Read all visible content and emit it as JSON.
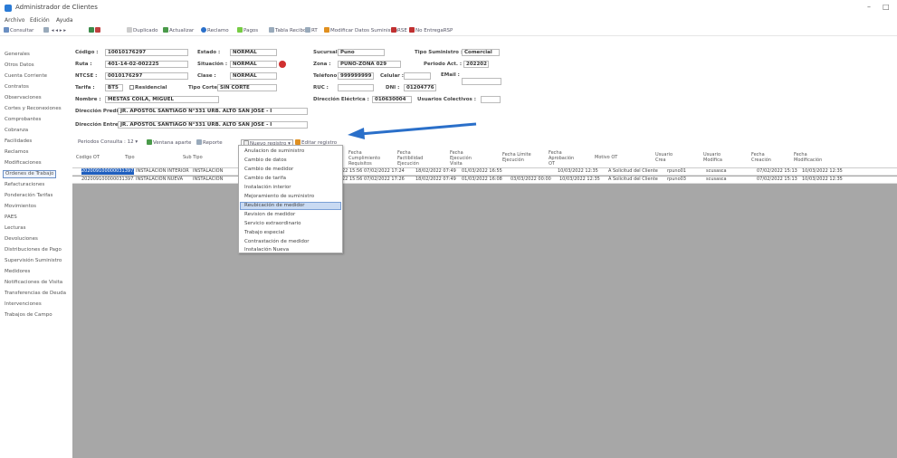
{
  "window": {
    "title": "Administrador de Clientes",
    "minimize": "–",
    "maximize": "□"
  },
  "menu": [
    "Archivo",
    "Edición",
    "Ayuda"
  ],
  "toolbar": {
    "consultar": "Consultar",
    "duplicado": "Duplicado",
    "actualizar": "Actualizar",
    "reclamo": "Reclamo",
    "pagos": "Pagos",
    "tabla_recibo": "Tabla Recibo",
    "rt": "RT",
    "modificar": "Modificar Datos Suministro",
    "rse": "RSE",
    "no_entrega": "No EntregaRSP"
  },
  "sidebar": [
    "Generales",
    "Otros Datos",
    "Cuenta Corriente",
    "Contratos",
    "Observaciones",
    "Cortes y Reconexiones",
    "Comprobantes",
    "Cobranza",
    "Facilidades",
    "Reclamos",
    "Modificaciones",
    "Ordenes de Trabajo",
    "Refacturaciones",
    "Ponderación Tarifas",
    "Movimientos",
    "PAES",
    "Lecturas",
    "Devoluciones",
    "Distribuciones de Pago",
    "Supervisión Suministro",
    "Medidores",
    "Notificaciones de Visita",
    "Transferencias de Deuda",
    "Intervenciones",
    "Trabajos de Campo"
  ],
  "sidebar_selected": "Ordenes de Trabajo",
  "form": {
    "codigo_label": "Código :",
    "codigo": "10010176297",
    "ruta_label": "Ruta :",
    "ruta": "401-14-02-002225",
    "ntcse_label": "NTCSE :",
    "ntcse": "0010176297",
    "tarifa_label": "Tarifa :",
    "tarifa": "BT5",
    "nombre_label": "Nombre :",
    "nombre": "MESTAS COILA, MIGUEL",
    "dir_predio_label": "Dirección Predio :",
    "dir_predio": "JR. APOSTOL SANTIAGO N°331 URB. ALTO SAN JOSE - I",
    "dir_entrega_label": "Dirección Entrega :",
    "dir_entrega": "JR. APOSTOL SANTIAGO N°331 URB. ALTO SAN JOSE - I",
    "estado_label": "Estado :",
    "estado": "NORMAL",
    "situacion_label": "Situación :",
    "situacion": "NORMAL",
    "clase_label": "Clase :",
    "clase": "NORMAL",
    "residencial_label": "Residencial",
    "tipo_corte_label": "Tipo Corte :",
    "tipo_corte": "SIN CORTE",
    "sucursal_label": "Sucursal :",
    "sucursal": "Puno",
    "zona_label": "Zona :",
    "zona": "PUNO-ZONA 029",
    "telefono_label": "Teléfono :",
    "telefono": "999999999",
    "celular_label": "Celular :",
    "celular": "",
    "ruc_label": "RUC :",
    "ruc": "",
    "dni_label": "DNI :",
    "dni": "01204776",
    "dir_electrica_label": "Dirección Eléctrica :",
    "dir_electrica": "010630004",
    "usuarios_colectivos_label": "Usuarios Colectivos :",
    "usuarios_colectivos": "",
    "tipo_suministro_label": "Tipo Suministro :",
    "tipo_suministro": "Comercial",
    "periodo_label": "Periodo Act. :",
    "periodo": "202202",
    "email_label": "EMail :",
    "email": ""
  },
  "controls": {
    "periodos_label": "Periodos Consulta : 12",
    "ventana_aparte": "Ventana aparte",
    "reporte": "Reporte",
    "nuevo_registro": "Nuevo registro",
    "editar_registro": "Editar registro"
  },
  "grid": {
    "headers": [
      "Codigo OT",
      "Tipo",
      "Sub Tipo",
      "",
      "Fecha Cumplimiento Requisitos",
      "Fecha Factibilidad Ejecución",
      "Fecha Ejecución Visita",
      "Fecha Límite Ejecución",
      "Fecha Aprobación OT",
      "Motivo OT",
      "Usuario Crea",
      "Usuario Modifica",
      "Fecha Creación",
      "Fecha Modificación"
    ],
    "rows": [
      [
        "20200910000003139732",
        "INSTALACION INTERIOR",
        "INSTALACION",
        "22 15:56",
        "07/02/2022 17:24",
        "18/02/2022 07:49",
        "01/03/2022 16:55",
        "",
        "10/03/2022 12:35",
        "A Solicitud del Cliente",
        "rpuno01",
        "scusasca",
        "07/02/2022 15:13",
        "10/03/2022 12:35"
      ],
      [
        "20200910000003139732",
        "INSTALACION NUEVA",
        "INSTALACION",
        "22 15:56",
        "07/02/2022 17:26",
        "18/02/2022 07:49",
        "01/03/2022 16:08",
        "03/03/2022 00:00",
        "10/03/2022 12:35",
        "A Solicitud del Cliente",
        "rpuno03",
        "scusasca",
        "07/02/2022 15:13",
        "10/03/2022 12:35"
      ]
    ]
  },
  "dropdown_items": [
    "Anulacion de suministro",
    "Cambio de datos",
    "Cambio de medidor",
    "Cambio de tarifa",
    "Instalación interior",
    "Mejoramiento de suministro",
    "Reubicación de medidor",
    "Revision de medidor",
    "Servicio extraordinario",
    "Trabajo especial",
    "Contrastación de medidor",
    "Instalación Nueva"
  ],
  "dropdown_selected": "Reubicación de medidor",
  "colors": {
    "accent": "#2a6fc9",
    "grid_bg": "#a7a7a7",
    "highlight": "#c9daf2",
    "selected_cell": "#1f5fbf"
  }
}
